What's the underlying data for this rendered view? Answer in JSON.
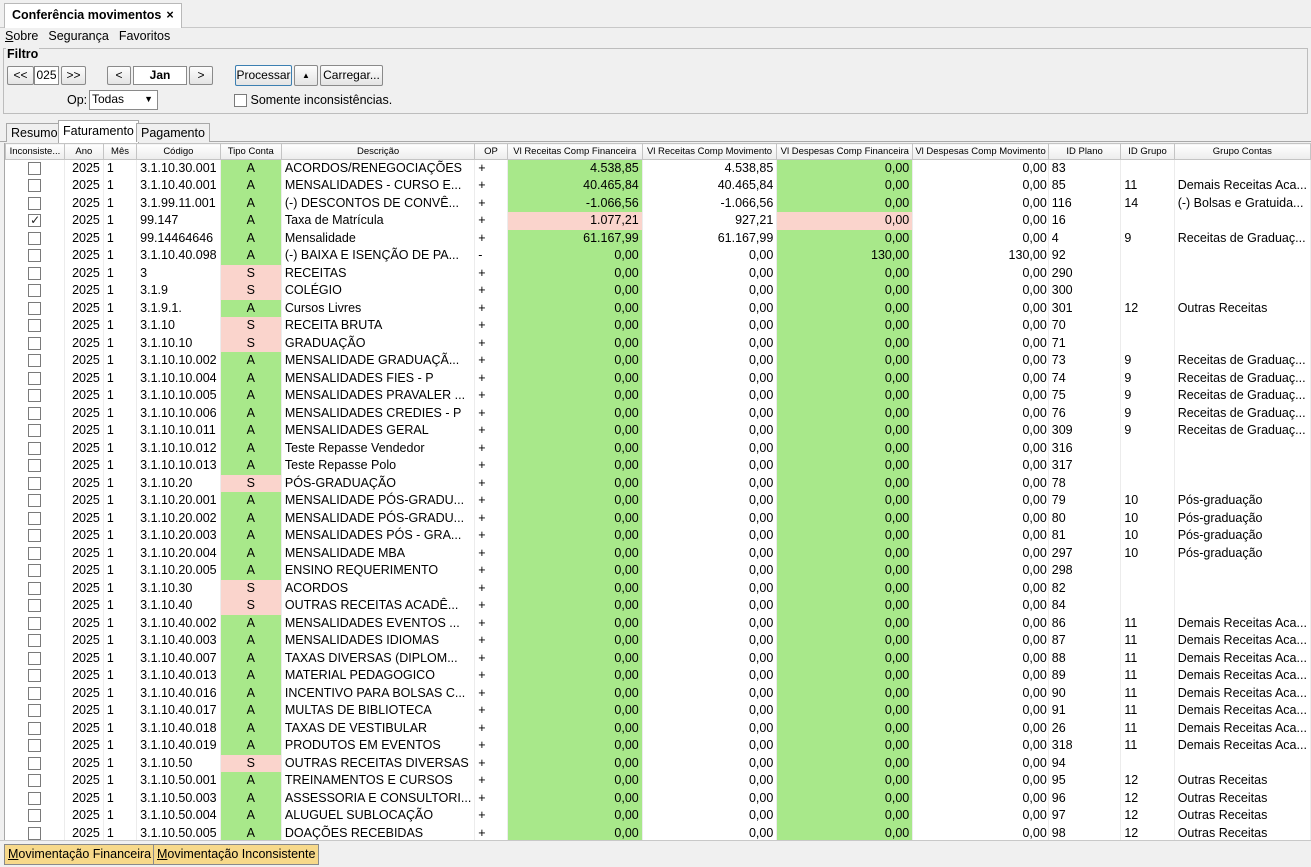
{
  "window": {
    "tab_title": "Conferência movimentos",
    "close_glyph": "×"
  },
  "menu": [
    "Sobre",
    "Segurança",
    "Favoritos"
  ],
  "filter": {
    "legend": "Filtro",
    "year_prev": "<<",
    "year": "025",
    "year_next": ">>",
    "month_prev": "<",
    "month": "Jan",
    "month_next": ">",
    "process": "Processar",
    "up": "▲",
    "load": "Carregar...",
    "op_label": "Op:",
    "op_value": "Todas",
    "only_label": "Somente inconsistências."
  },
  "tabs": [
    "Resumo",
    "Faturamento",
    "Pagamento"
  ],
  "active_tab": "Faturamento",
  "columns": [
    "Inconsiste...",
    "Ano",
    "Mês",
    "Código",
    "Tipo Conta",
    "Descrição",
    "OP",
    "Vl Receitas Comp Financeira",
    "Vl Receitas Comp Movimento",
    "Vl Despesas Comp Financeira",
    "Vl Despesas Comp Movimento",
    "ID Plano",
    "ID Grupo",
    "Grupo Contas"
  ],
  "colors": {
    "green": "#a8e88a",
    "pink": "#fad4cc",
    "button_yellow": "#f7d98a"
  },
  "rows": [
    {
      "chk": false,
      "ano": "2025",
      "mes": "1",
      "cod": "3.1.10.30.001",
      "tipo": "A",
      "desc": "ACORDOS/RENEGOCIAÇÕES",
      "op": "+",
      "rf": "4.538,85",
      "rm": "4.538,85",
      "df": "0,00",
      "dm": "0,00",
      "plano": "83",
      "grupo": "",
      "gcontas": "",
      "bad": false
    },
    {
      "chk": false,
      "ano": "2025",
      "mes": "1",
      "cod": "3.1.10.40.001",
      "tipo": "A",
      "desc": "MENSALIDADES - CURSO E...",
      "op": "+",
      "rf": "40.465,84",
      "rm": "40.465,84",
      "df": "0,00",
      "dm": "0,00",
      "plano": "85",
      "grupo": "11",
      "gcontas": "Demais Receitas Aca...",
      "bad": false
    },
    {
      "chk": false,
      "ano": "2025",
      "mes": "1",
      "cod": "3.1.99.11.001",
      "tipo": "A",
      "desc": "(-) DESCONTOS DE CONVÊ...",
      "op": "+",
      "rf": "-1.066,56",
      "rm": "-1.066,56",
      "df": "0,00",
      "dm": "0,00",
      "plano": "116",
      "grupo": "14",
      "gcontas": "(-) Bolsas e Gratuida...",
      "bad": false
    },
    {
      "chk": true,
      "ano": "2025",
      "mes": "1",
      "cod": "99.147",
      "tipo": "A",
      "desc": "Taxa de Matrícula",
      "op": "+",
      "rf": "1.077,21",
      "rm": "927,21",
      "df": "0,00",
      "dm": "0,00",
      "plano": "16",
      "grupo": "",
      "gcontas": "",
      "bad": true
    },
    {
      "chk": false,
      "ano": "2025",
      "mes": "1",
      "cod": "99.14464646",
      "tipo": "A",
      "desc": "Mensalidade",
      "op": "+",
      "rf": "61.167,99",
      "rm": "61.167,99",
      "df": "0,00",
      "dm": "0,00",
      "plano": "4",
      "grupo": "9",
      "gcontas": "Receitas de Graduaç...",
      "bad": false
    },
    {
      "chk": false,
      "ano": "2025",
      "mes": "1",
      "cod": "3.1.10.40.098",
      "tipo": "A",
      "desc": "(-) BAIXA E ISENÇÃO DE PA...",
      "op": "-",
      "rf": "0,00",
      "rm": "0,00",
      "df": "130,00",
      "dm": "130,00",
      "plano": "92",
      "grupo": "",
      "gcontas": "",
      "bad": false
    },
    {
      "chk": false,
      "ano": "2025",
      "mes": "1",
      "cod": "3",
      "tipo": "S",
      "desc": "RECEITAS",
      "op": "+",
      "rf": "0,00",
      "rm": "0,00",
      "df": "0,00",
      "dm": "0,00",
      "plano": "290",
      "grupo": "",
      "gcontas": "",
      "bad": false
    },
    {
      "chk": false,
      "ano": "2025",
      "mes": "1",
      "cod": "3.1.9",
      "tipo": "S",
      "desc": "COLÉGIO",
      "op": "+",
      "rf": "0,00",
      "rm": "0,00",
      "df": "0,00",
      "dm": "0,00",
      "plano": "300",
      "grupo": "",
      "gcontas": "",
      "bad": false
    },
    {
      "chk": false,
      "ano": "2025",
      "mes": "1",
      "cod": "3.1.9.1.",
      "tipo": "A",
      "desc": "Cursos Livres",
      "op": "+",
      "rf": "0,00",
      "rm": "0,00",
      "df": "0,00",
      "dm": "0,00",
      "plano": "301",
      "grupo": "12",
      "gcontas": "Outras Receitas",
      "bad": false
    },
    {
      "chk": false,
      "ano": "2025",
      "mes": "1",
      "cod": "3.1.10",
      "tipo": "S",
      "desc": "RECEITA BRUTA",
      "op": "+",
      "rf": "0,00",
      "rm": "0,00",
      "df": "0,00",
      "dm": "0,00",
      "plano": "70",
      "grupo": "",
      "gcontas": "",
      "bad": false
    },
    {
      "chk": false,
      "ano": "2025",
      "mes": "1",
      "cod": "3.1.10.10",
      "tipo": "S",
      "desc": "GRADUAÇÃO",
      "op": "+",
      "rf": "0,00",
      "rm": "0,00",
      "df": "0,00",
      "dm": "0,00",
      "plano": "71",
      "grupo": "",
      "gcontas": "",
      "bad": false
    },
    {
      "chk": false,
      "ano": "2025",
      "mes": "1",
      "cod": "3.1.10.10.002",
      "tipo": "A",
      "desc": "MENSALIDADE GRADUAÇÃ...",
      "op": "+",
      "rf": "0,00",
      "rm": "0,00",
      "df": "0,00",
      "dm": "0,00",
      "plano": "73",
      "grupo": "9",
      "gcontas": "Receitas de Graduaç...",
      "bad": false
    },
    {
      "chk": false,
      "ano": "2025",
      "mes": "1",
      "cod": "3.1.10.10.004",
      "tipo": "A",
      "desc": "MENSALIDADES FIES - P",
      "op": "+",
      "rf": "0,00",
      "rm": "0,00",
      "df": "0,00",
      "dm": "0,00",
      "plano": "74",
      "grupo": "9",
      "gcontas": "Receitas de Graduaç...",
      "bad": false
    },
    {
      "chk": false,
      "ano": "2025",
      "mes": "1",
      "cod": "3.1.10.10.005",
      "tipo": "A",
      "desc": "MENSALIDADES PRAVALER ...",
      "op": "+",
      "rf": "0,00",
      "rm": "0,00",
      "df": "0,00",
      "dm": "0,00",
      "plano": "75",
      "grupo": "9",
      "gcontas": "Receitas de Graduaç...",
      "bad": false
    },
    {
      "chk": false,
      "ano": "2025",
      "mes": "1",
      "cod": "3.1.10.10.006",
      "tipo": "A",
      "desc": "MENSALIDADES CREDIES - P",
      "op": "+",
      "rf": "0,00",
      "rm": "0,00",
      "df": "0,00",
      "dm": "0,00",
      "plano": "76",
      "grupo": "9",
      "gcontas": "Receitas de Graduaç...",
      "bad": false
    },
    {
      "chk": false,
      "ano": "2025",
      "mes": "1",
      "cod": "3.1.10.10.011",
      "tipo": "A",
      "desc": "MENSALIDADES GERAL",
      "op": "+",
      "rf": "0,00",
      "rm": "0,00",
      "df": "0,00",
      "dm": "0,00",
      "plano": "309",
      "grupo": "9",
      "gcontas": "Receitas de Graduaç...",
      "bad": false
    },
    {
      "chk": false,
      "ano": "2025",
      "mes": "1",
      "cod": "3.1.10.10.012",
      "tipo": "A",
      "desc": "Teste Repasse Vendedor",
      "op": "+",
      "rf": "0,00",
      "rm": "0,00",
      "df": "0,00",
      "dm": "0,00",
      "plano": "316",
      "grupo": "",
      "gcontas": "",
      "bad": false
    },
    {
      "chk": false,
      "ano": "2025",
      "mes": "1",
      "cod": "3.1.10.10.013",
      "tipo": "A",
      "desc": "Teste Repasse Polo",
      "op": "+",
      "rf": "0,00",
      "rm": "0,00",
      "df": "0,00",
      "dm": "0,00",
      "plano": "317",
      "grupo": "",
      "gcontas": "",
      "bad": false
    },
    {
      "chk": false,
      "ano": "2025",
      "mes": "1",
      "cod": "3.1.10.20",
      "tipo": "S",
      "desc": "PÓS-GRADUAÇÃO",
      "op": "+",
      "rf": "0,00",
      "rm": "0,00",
      "df": "0,00",
      "dm": "0,00",
      "plano": "78",
      "grupo": "",
      "gcontas": "",
      "bad": false
    },
    {
      "chk": false,
      "ano": "2025",
      "mes": "1",
      "cod": "3.1.10.20.001",
      "tipo": "A",
      "desc": "MENSALIDADE PÓS-GRADU...",
      "op": "+",
      "rf": "0,00",
      "rm": "0,00",
      "df": "0,00",
      "dm": "0,00",
      "plano": "79",
      "grupo": "10",
      "gcontas": "Pós-graduação",
      "bad": false
    },
    {
      "chk": false,
      "ano": "2025",
      "mes": "1",
      "cod": "3.1.10.20.002",
      "tipo": "A",
      "desc": "MENSALIDADE PÓS-GRADU...",
      "op": "+",
      "rf": "0,00",
      "rm": "0,00",
      "df": "0,00",
      "dm": "0,00",
      "plano": "80",
      "grupo": "10",
      "gcontas": "Pós-graduação",
      "bad": false
    },
    {
      "chk": false,
      "ano": "2025",
      "mes": "1",
      "cod": "3.1.10.20.003",
      "tipo": "A",
      "desc": "MENSALIDADES PÓS - GRA...",
      "op": "+",
      "rf": "0,00",
      "rm": "0,00",
      "df": "0,00",
      "dm": "0,00",
      "plano": "81",
      "grupo": "10",
      "gcontas": "Pós-graduação",
      "bad": false
    },
    {
      "chk": false,
      "ano": "2025",
      "mes": "1",
      "cod": "3.1.10.20.004",
      "tipo": "A",
      "desc": "MENSALIDADE MBA",
      "op": "+",
      "rf": "0,00",
      "rm": "0,00",
      "df": "0,00",
      "dm": "0,00",
      "plano": "297",
      "grupo": "10",
      "gcontas": "Pós-graduação",
      "bad": false
    },
    {
      "chk": false,
      "ano": "2025",
      "mes": "1",
      "cod": "3.1.10.20.005",
      "tipo": "A",
      "desc": "ENSINO REQUERIMENTO",
      "op": "+",
      "rf": "0,00",
      "rm": "0,00",
      "df": "0,00",
      "dm": "0,00",
      "plano": "298",
      "grupo": "",
      "gcontas": "",
      "bad": false
    },
    {
      "chk": false,
      "ano": "2025",
      "mes": "1",
      "cod": "3.1.10.30",
      "tipo": "S",
      "desc": "ACORDOS",
      "op": "+",
      "rf": "0,00",
      "rm": "0,00",
      "df": "0,00",
      "dm": "0,00",
      "plano": "82",
      "grupo": "",
      "gcontas": "",
      "bad": false
    },
    {
      "chk": false,
      "ano": "2025",
      "mes": "1",
      "cod": "3.1.10.40",
      "tipo": "S",
      "desc": "OUTRAS RECEITAS ACADÊ...",
      "op": "+",
      "rf": "0,00",
      "rm": "0,00",
      "df": "0,00",
      "dm": "0,00",
      "plano": "84",
      "grupo": "",
      "gcontas": "",
      "bad": false
    },
    {
      "chk": false,
      "ano": "2025",
      "mes": "1",
      "cod": "3.1.10.40.002",
      "tipo": "A",
      "desc": "MENSALIDADES EVENTOS ...",
      "op": "+",
      "rf": "0,00",
      "rm": "0,00",
      "df": "0,00",
      "dm": "0,00",
      "plano": "86",
      "grupo": "11",
      "gcontas": "Demais Receitas Aca...",
      "bad": false
    },
    {
      "chk": false,
      "ano": "2025",
      "mes": "1",
      "cod": "3.1.10.40.003",
      "tipo": "A",
      "desc": "MENSALIDADES IDIOMAS",
      "op": "+",
      "rf": "0,00",
      "rm": "0,00",
      "df": "0,00",
      "dm": "0,00",
      "plano": "87",
      "grupo": "11",
      "gcontas": "Demais Receitas Aca...",
      "bad": false
    },
    {
      "chk": false,
      "ano": "2025",
      "mes": "1",
      "cod": "3.1.10.40.007",
      "tipo": "A",
      "desc": "TAXAS DIVERSAS (DIPLOM...",
      "op": "+",
      "rf": "0,00",
      "rm": "0,00",
      "df": "0,00",
      "dm": "0,00",
      "plano": "88",
      "grupo": "11",
      "gcontas": "Demais Receitas Aca...",
      "bad": false
    },
    {
      "chk": false,
      "ano": "2025",
      "mes": "1",
      "cod": "3.1.10.40.013",
      "tipo": "A",
      "desc": "MATERIAL PEDAGOGICO",
      "op": "+",
      "rf": "0,00",
      "rm": "0,00",
      "df": "0,00",
      "dm": "0,00",
      "plano": "89",
      "grupo": "11",
      "gcontas": "Demais Receitas Aca...",
      "bad": false
    },
    {
      "chk": false,
      "ano": "2025",
      "mes": "1",
      "cod": "3.1.10.40.016",
      "tipo": "A",
      "desc": "INCENTIVO PARA BOLSAS C...",
      "op": "+",
      "rf": "0,00",
      "rm": "0,00",
      "df": "0,00",
      "dm": "0,00",
      "plano": "90",
      "grupo": "11",
      "gcontas": "Demais Receitas Aca...",
      "bad": false
    },
    {
      "chk": false,
      "ano": "2025",
      "mes": "1",
      "cod": "3.1.10.40.017",
      "tipo": "A",
      "desc": "MULTAS DE BIBLIOTECA",
      "op": "+",
      "rf": "0,00",
      "rm": "0,00",
      "df": "0,00",
      "dm": "0,00",
      "plano": "91",
      "grupo": "11",
      "gcontas": "Demais Receitas Aca...",
      "bad": false
    },
    {
      "chk": false,
      "ano": "2025",
      "mes": "1",
      "cod": "3.1.10.40.018",
      "tipo": "A",
      "desc": "TAXAS DE VESTIBULAR",
      "op": "+",
      "rf": "0,00",
      "rm": "0,00",
      "df": "0,00",
      "dm": "0,00",
      "plano": "26",
      "grupo": "11",
      "gcontas": "Demais Receitas Aca...",
      "bad": false
    },
    {
      "chk": false,
      "ano": "2025",
      "mes": "1",
      "cod": "3.1.10.40.019",
      "tipo": "A",
      "desc": "PRODUTOS EM EVENTOS",
      "op": "+",
      "rf": "0,00",
      "rm": "0,00",
      "df": "0,00",
      "dm": "0,00",
      "plano": "318",
      "grupo": "11",
      "gcontas": "Demais Receitas Aca...",
      "bad": false
    },
    {
      "chk": false,
      "ano": "2025",
      "mes": "1",
      "cod": "3.1.10.50",
      "tipo": "S",
      "desc": "OUTRAS RECEITAS DIVERSAS",
      "op": "+",
      "rf": "0,00",
      "rm": "0,00",
      "df": "0,00",
      "dm": "0,00",
      "plano": "94",
      "grupo": "",
      "gcontas": "",
      "bad": false
    },
    {
      "chk": false,
      "ano": "2025",
      "mes": "1",
      "cod": "3.1.10.50.001",
      "tipo": "A",
      "desc": "TREINAMENTOS E CURSOS",
      "op": "+",
      "rf": "0,00",
      "rm": "0,00",
      "df": "0,00",
      "dm": "0,00",
      "plano": "95",
      "grupo": "12",
      "gcontas": "Outras Receitas",
      "bad": false
    },
    {
      "chk": false,
      "ano": "2025",
      "mes": "1",
      "cod": "3.1.10.50.003",
      "tipo": "A",
      "desc": "ASSESSORIA E CONSULTORI...",
      "op": "+",
      "rf": "0,00",
      "rm": "0,00",
      "df": "0,00",
      "dm": "0,00",
      "plano": "96",
      "grupo": "12",
      "gcontas": "Outras Receitas",
      "bad": false
    },
    {
      "chk": false,
      "ano": "2025",
      "mes": "1",
      "cod": "3.1.10.50.004",
      "tipo": "A",
      "desc": "ALUGUEL SUBLOCAÇÃO",
      "op": "+",
      "rf": "0,00",
      "rm": "0,00",
      "df": "0,00",
      "dm": "0,00",
      "plano": "97",
      "grupo": "12",
      "gcontas": "Outras Receitas",
      "bad": false
    },
    {
      "chk": false,
      "ano": "2025",
      "mes": "1",
      "cod": "3.1.10.50.005",
      "tipo": "A",
      "desc": "DOAÇÕES RECEBIDAS",
      "op": "+",
      "rf": "0,00",
      "rm": "0,00",
      "df": "0,00",
      "dm": "0,00",
      "plano": "98",
      "grupo": "12",
      "gcontas": "Outras Receitas",
      "bad": false
    }
  ],
  "bottom": {
    "btn1_first": "M",
    "btn1_rest": "ovimentação Financeira",
    "btn2_first": "M",
    "btn2_rest": "ovimentação Inconsistente"
  }
}
